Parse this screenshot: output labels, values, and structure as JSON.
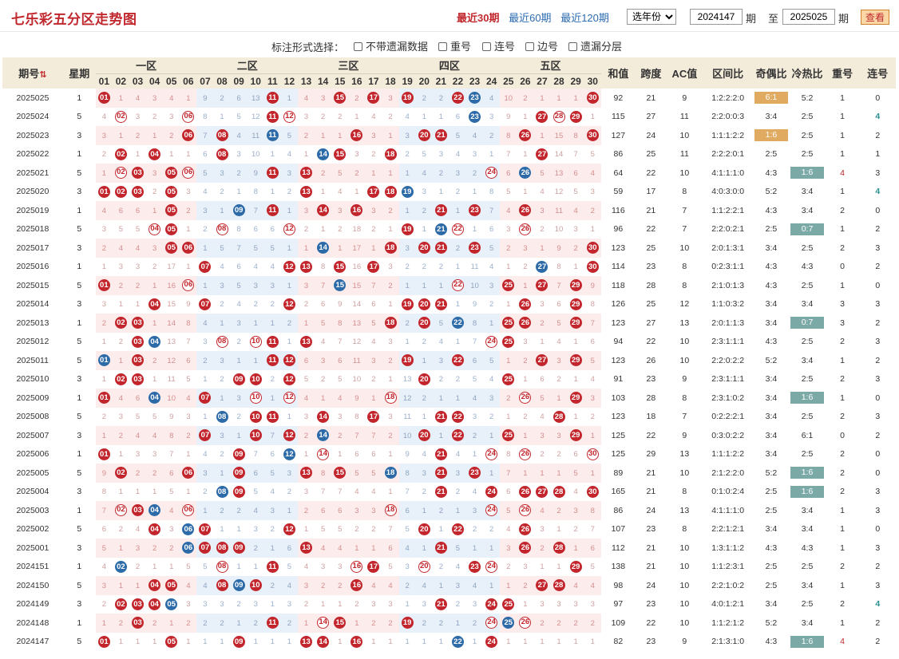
{
  "title": "七乐彩五分区走势图",
  "periods": [
    {
      "label": "最近30期",
      "active": true
    },
    {
      "label": "最近60期",
      "active": false
    },
    {
      "label": "最近120期",
      "active": false
    }
  ],
  "year_select": "选年份",
  "range": {
    "from": "2024147",
    "qi": "期",
    "to_label": "至",
    "to": "2025025"
  },
  "view_button": "查看",
  "options": {
    "label": "标注形式选择：",
    "items": [
      "不带遗漏数据",
      "重号",
      "连号",
      "边号",
      "遗漏分层"
    ]
  },
  "headers": {
    "issue": "期号",
    "sort_icon": "sort-icon",
    "week": "星期",
    "zones": [
      "一区",
      "二区",
      "三区",
      "四区",
      "五区"
    ],
    "stats": [
      "和值",
      "跨度",
      "AC值",
      "区间比",
      "奇偶比",
      "冷热比",
      "重号",
      "连号"
    ]
  },
  "numbers": [
    "01",
    "02",
    "03",
    "04",
    "05",
    "06",
    "07",
    "08",
    "09",
    "10",
    "11",
    "12",
    "13",
    "14",
    "15",
    "16",
    "17",
    "18",
    "19",
    "20",
    "21",
    "22",
    "23",
    "24",
    "25",
    "26",
    "27",
    "28",
    "29",
    "30"
  ],
  "rows": [
    {
      "issue": "2025025",
      "week": "1",
      "main": [
        1,
        11,
        15,
        17,
        19,
        22,
        30
      ],
      "special": 23,
      "sum": "92",
      "span": "21",
      "ac": "9",
      "zone": "1:2:2:2:0",
      "oe": "6:1",
      "hc": "5:2",
      "rep": "1",
      "con": "0"
    },
    {
      "issue": "2025024",
      "week": "5",
      "main": [
        2,
        6,
        11,
        12,
        27,
        28,
        29
      ],
      "special": 23,
      "sum": "115",
      "span": "27",
      "ac": "11",
      "zone": "2:2:0:0:3",
      "oe": "3:4",
      "hc": "2:5",
      "rep": "1",
      "con": "4"
    },
    {
      "issue": "2025023",
      "week": "3",
      "main": [
        6,
        8,
        16,
        20,
        21,
        26,
        30
      ],
      "special": 11,
      "sum": "127",
      "span": "24",
      "ac": "10",
      "zone": "1:1:1:2:2",
      "oe": "1:6",
      "hc": "2:5",
      "rep": "1",
      "con": "2"
    },
    {
      "issue": "2025022",
      "week": "1",
      "main": [
        2,
        4,
        8,
        15,
        18,
        27
      ],
      "special": 14,
      "sum": "86",
      "span": "25",
      "ac": "11",
      "zone": "2:2:2:0:1",
      "oe": "2:5",
      "hc": "2:5",
      "rep": "1",
      "con": "1"
    },
    {
      "issue": "2025021",
      "week": "5",
      "main": [
        2,
        3,
        5,
        6,
        11,
        13,
        24
      ],
      "special": 26,
      "sum": "64",
      "span": "22",
      "ac": "10",
      "zone": "4:1:1:1:0",
      "oe": "4:3",
      "hc": "1:6",
      "rep": "4",
      "con": "3"
    },
    {
      "issue": "2025020",
      "week": "3",
      "main": [
        1,
        2,
        3,
        5,
        13,
        17,
        18
      ],
      "special": 19,
      "sum": "59",
      "span": "17",
      "ac": "8",
      "zone": "4:0:3:0:0",
      "oe": "5:2",
      "hc": "3:4",
      "rep": "1",
      "con": "4"
    },
    {
      "issue": "2025019",
      "week": "1",
      "main": [
        5,
        11,
        14,
        16,
        21,
        23,
        26
      ],
      "special": 9,
      "sum": "116",
      "span": "21",
      "ac": "7",
      "zone": "1:1:2:2:1",
      "oe": "4:3",
      "hc": "3:4",
      "rep": "2",
      "con": "0"
    },
    {
      "issue": "2025018",
      "week": "5",
      "main": [
        4,
        5,
        8,
        12,
        19,
        22,
        26
      ],
      "special": 21,
      "sum": "96",
      "span": "22",
      "ac": "7",
      "zone": "2:2:0:2:1",
      "oe": "2:5",
      "hc": "0:7",
      "rep": "1",
      "con": "2"
    },
    {
      "issue": "2025017",
      "week": "3",
      "main": [
        5,
        6,
        18,
        20,
        21,
        23,
        30
      ],
      "special": 14,
      "sum": "123",
      "span": "25",
      "ac": "10",
      "zone": "2:0:1:3:1",
      "oe": "3:4",
      "hc": "2:5",
      "rep": "2",
      "con": "3"
    },
    {
      "issue": "2025016",
      "week": "1",
      "main": [
        7,
        12,
        13,
        15,
        17,
        30
      ],
      "special": 27,
      "sum": "114",
      "span": "23",
      "ac": "8",
      "zone": "0:2:3:1:1",
      "oe": "4:3",
      "hc": "4:3",
      "rep": "0",
      "con": "2"
    },
    {
      "issue": "2025015",
      "week": "5",
      "main": [
        1,
        6,
        22,
        25,
        27,
        29
      ],
      "special": 15,
      "sum": "118",
      "span": "28",
      "ac": "8",
      "zone": "2:1:0:1:3",
      "oe": "4:3",
      "hc": "2:5",
      "rep": "1",
      "con": "0"
    },
    {
      "issue": "2025014",
      "week": "3",
      "main": [
        4,
        7,
        12,
        19,
        20,
        21,
        26,
        29
      ],
      "special": 0,
      "sum": "126",
      "span": "25",
      "ac": "12",
      "zone": "1:1:0:3:2",
      "oe": "3:4",
      "hc": "3:4",
      "rep": "3",
      "con": "3"
    },
    {
      "issue": "2025013",
      "week": "1",
      "main": [
        2,
        3,
        18,
        20,
        25,
        26,
        29
      ],
      "special": 22,
      "sum": "123",
      "span": "27",
      "ac": "13",
      "zone": "2:0:1:1:3",
      "oe": "3:4",
      "hc": "0:7",
      "rep": "3",
      "con": "2"
    },
    {
      "issue": "2025012",
      "week": "5",
      "main": [
        3,
        8,
        10,
        11,
        13,
        24,
        25
      ],
      "special": 4,
      "sum": "94",
      "span": "22",
      "ac": "10",
      "zone": "2:3:1:1:1",
      "oe": "4:3",
      "hc": "2:5",
      "rep": "2",
      "con": "3"
    },
    {
      "issue": "2025011",
      "week": "5",
      "main": [
        3,
        11,
        12,
        19,
        22,
        27,
        29
      ],
      "special": 1,
      "sum": "123",
      "span": "26",
      "ac": "10",
      "zone": "2:2:0:2:2",
      "oe": "5:2",
      "hc": "3:4",
      "rep": "1",
      "con": "2"
    },
    {
      "issue": "2025010",
      "week": "3",
      "main": [
        2,
        3,
        9,
        10,
        12,
        20,
        25
      ],
      "special": 0,
      "sum": "91",
      "span": "23",
      "ac": "9",
      "zone": "2:3:1:1:1",
      "oe": "3:4",
      "hc": "2:5",
      "rep": "2",
      "con": "3"
    },
    {
      "issue": "2025009",
      "week": "1",
      "main": [
        1,
        7,
        10,
        12,
        18,
        26,
        29
      ],
      "special": 4,
      "sum": "103",
      "span": "28",
      "ac": "8",
      "zone": "2:3:1:0:2",
      "oe": "3:4",
      "hc": "1:6",
      "rep": "1",
      "con": "0"
    },
    {
      "issue": "2025008",
      "week": "5",
      "main": [
        10,
        11,
        14,
        17,
        21,
        22,
        28
      ],
      "special": 8,
      "sum": "123",
      "span": "18",
      "ac": "7",
      "zone": "0:2:2:2:1",
      "oe": "3:4",
      "hc": "2:5",
      "rep": "2",
      "con": "3"
    },
    {
      "issue": "2025007",
      "week": "3",
      "main": [
        7,
        10,
        12,
        20,
        22,
        25,
        29
      ],
      "special": 14,
      "sum": "125",
      "span": "22",
      "ac": "9",
      "zone": "0:3:0:2:2",
      "oe": "3:4",
      "hc": "6:1",
      "rep": "0",
      "con": "2"
    },
    {
      "issue": "2025006",
      "week": "1",
      "main": [
        1,
        9,
        14,
        21,
        24,
        26,
        30
      ],
      "special": 12,
      "sum": "125",
      "span": "29",
      "ac": "13",
      "zone": "1:1:1:2:2",
      "oe": "3:4",
      "hc": "2:5",
      "rep": "2",
      "con": "0"
    },
    {
      "issue": "2025005",
      "week": "5",
      "main": [
        2,
        6,
        9,
        13,
        15,
        21,
        23
      ],
      "special": 18,
      "sum": "89",
      "span": "21",
      "ac": "10",
      "zone": "2:1:2:2:0",
      "oe": "5:2",
      "hc": "1:6",
      "rep": "2",
      "con": "0"
    },
    {
      "issue": "2025004",
      "week": "3",
      "main": [
        9,
        21,
        24,
        26,
        27,
        28,
        30
      ],
      "special": 8,
      "sum": "165",
      "span": "21",
      "ac": "8",
      "zone": "0:1:0:2:4",
      "oe": "2:5",
      "hc": "1:6",
      "rep": "2",
      "con": "3"
    },
    {
      "issue": "2025003",
      "week": "1",
      "main": [
        2,
        3,
        6,
        18,
        24,
        26
      ],
      "special": 4,
      "sum": "86",
      "span": "24",
      "ac": "13",
      "zone": "4:1:1:1:0",
      "oe": "2:5",
      "hc": "3:4",
      "rep": "1",
      "con": "3"
    },
    {
      "issue": "2025002",
      "week": "5",
      "main": [
        4,
        7,
        12,
        20,
        22,
        26
      ],
      "special": 6,
      "sum": "107",
      "span": "23",
      "ac": "8",
      "zone": "2:2:1:2:1",
      "oe": "3:4",
      "hc": "3:4",
      "rep": "1",
      "con": "0"
    },
    {
      "issue": "2025001",
      "week": "3",
      "main": [
        7,
        8,
        9,
        13,
        21,
        26,
        28
      ],
      "special": 6,
      "sum": "112",
      "span": "21",
      "ac": "10",
      "zone": "1:3:1:1:2",
      "oe": "4:3",
      "hc": "4:3",
      "rep": "1",
      "con": "3"
    },
    {
      "issue": "2024151",
      "week": "1",
      "main": [
        8,
        11,
        16,
        17,
        20,
        23,
        24,
        29
      ],
      "special": 2,
      "sum": "138",
      "span": "21",
      "ac": "10",
      "zone": "1:1:2:3:1",
      "oe": "2:5",
      "hc": "2:5",
      "rep": "2",
      "con": "2"
    },
    {
      "issue": "2024150",
      "week": "5",
      "main": [
        4,
        5,
        8,
        10,
        16,
        27,
        28
      ],
      "special": 9,
      "sum": "98",
      "span": "24",
      "ac": "10",
      "zone": "2:2:1:0:2",
      "oe": "2:5",
      "hc": "3:4",
      "rep": "1",
      "con": "3"
    },
    {
      "issue": "2024149",
      "week": "3",
      "main": [
        2,
        3,
        4,
        21,
        24,
        25
      ],
      "special": 5,
      "sum": "97",
      "span": "23",
      "ac": "10",
      "zone": "4:0:1:2:1",
      "oe": "3:4",
      "hc": "2:5",
      "rep": "2",
      "con": "4"
    },
    {
      "issue": "2024148",
      "week": "1",
      "main": [
        3,
        11,
        14,
        15,
        19,
        24,
        26
      ],
      "special": 25,
      "sum": "109",
      "span": "22",
      "ac": "10",
      "zone": "1:1:2:1:2",
      "oe": "5:2",
      "hc": "3:4",
      "rep": "1",
      "con": "2"
    },
    {
      "issue": "2024147",
      "week": "5",
      "main": [
        1,
        5,
        9,
        13,
        14,
        16,
        24
      ],
      "special": 22,
      "sum": "82",
      "span": "23",
      "ac": "9",
      "zone": "2:1:3:1:0",
      "oe": "4:3",
      "hc": "1:6",
      "rep": "4",
      "con": "2"
    }
  ]
}
